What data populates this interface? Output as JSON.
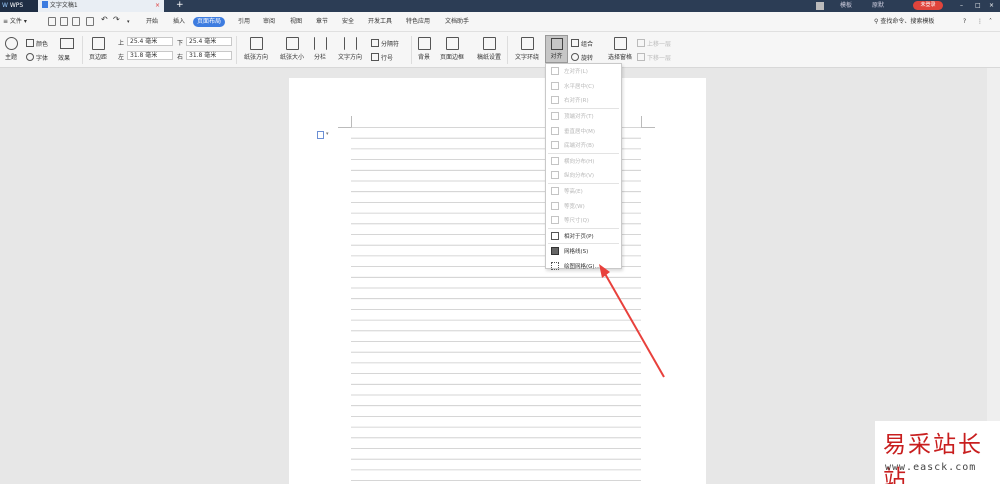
{
  "titlebar": {
    "app_tab": "WPS",
    "doc_tab": "文字文稿1",
    "close_x": "×",
    "add_tab": "+",
    "right_items": [
      "模板",
      "原默"
    ],
    "login_label": "未登录",
    "window_controls": [
      "–",
      "□",
      "×"
    ]
  },
  "menubar": {
    "file_label": "≡ 文件 ▾",
    "tabs": [
      "开始",
      "插入",
      "页面布局",
      "引用",
      "审阅",
      "视图",
      "章节",
      "安全",
      "开发工具",
      "特色应用",
      "文档助手"
    ],
    "active_tab": "页面布局",
    "search_label": "查找命令、搜索模板",
    "help_icon": "?"
  },
  "ribbon": {
    "theme": "主题",
    "colors": "颜色",
    "fonts": "字体",
    "effects": "效果",
    "margins": "页边距",
    "top_label": "上",
    "top_value": "25.4 毫米",
    "bottom_label": "下",
    "bottom_value": "25.4 毫米",
    "left_label": "左",
    "left_value": "31.8 毫米",
    "right_label": "右",
    "right_value": "31.8 毫米",
    "orientation": "纸张方向",
    "size": "纸张大小",
    "columns": "分栏",
    "text_direction": "文字方向",
    "breaks": "分隔符",
    "line_numbers": "行号",
    "background": "背景",
    "page_border": "页面边框",
    "paper_setup": "稿纸设置",
    "wrap_text": "文字环绕",
    "align": "对齐",
    "group": "组合",
    "rotate": "旋转",
    "selection_pane": "选择窗格",
    "bring_forward": "上移一层",
    "send_backward": "下移一层"
  },
  "align_menu": {
    "items": [
      {
        "label": "左对齐(L)",
        "enabled": false
      },
      {
        "label": "水平居中(C)",
        "enabled": false
      },
      {
        "label": "右对齐(R)",
        "enabled": false
      },
      {
        "label": "顶端对齐(T)",
        "enabled": false
      },
      {
        "label": "垂直居中(M)",
        "enabled": false
      },
      {
        "label": "底端对齐(B)",
        "enabled": false
      },
      {
        "label": "横向分布(H)",
        "enabled": false
      },
      {
        "label": "纵向分布(V)",
        "enabled": false
      },
      {
        "label": "等高(E)",
        "enabled": false
      },
      {
        "label": "等宽(W)",
        "enabled": false
      },
      {
        "label": "等尺寸(Q)",
        "enabled": false
      },
      {
        "label": "相对于页(P)",
        "enabled": true
      },
      {
        "label": "网格线(S)",
        "enabled": true,
        "checked": true
      },
      {
        "label": "绘图网格(G)...",
        "enabled": true
      }
    ]
  },
  "watermark": {
    "title": "易采站长站",
    "url": "www.easck.com"
  },
  "colors": {
    "accent": "#3d7ce0",
    "titlebar": "#2c3d55",
    "login": "#e0443b",
    "arrow": "#e8413c",
    "watermark": "#c81e1e"
  }
}
